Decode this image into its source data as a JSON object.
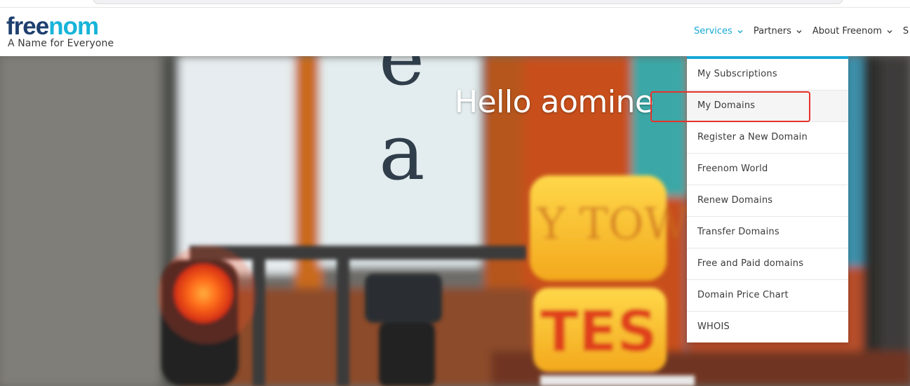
{
  "brand": {
    "logo_free": "free",
    "logo_nom": "nom",
    "tagline": "A Name for Everyone"
  },
  "nav": {
    "items": [
      {
        "label": "Services",
        "active": true
      },
      {
        "label": "Partners",
        "active": false
      },
      {
        "label": "About Freenom",
        "active": false
      },
      {
        "label": "S",
        "active": false
      }
    ]
  },
  "hero": {
    "greeting": "Hello aomine"
  },
  "services_menu": {
    "items": [
      {
        "label": "My Subscriptions"
      },
      {
        "label": "My Domains"
      },
      {
        "label": "Register a New Domain"
      },
      {
        "label": "Freenom World"
      },
      {
        "label": "Renew Domains"
      },
      {
        "label": "Transfer Domains"
      },
      {
        "label": "Free and Paid domains"
      },
      {
        "label": "Domain Price Chart"
      },
      {
        "label": "WHOIS"
      }
    ]
  },
  "colors": {
    "accent": "#18a9d4",
    "logo_dark": "#1f3f6f",
    "logo_light": "#16b4d9",
    "highlight": "#e8322b"
  }
}
